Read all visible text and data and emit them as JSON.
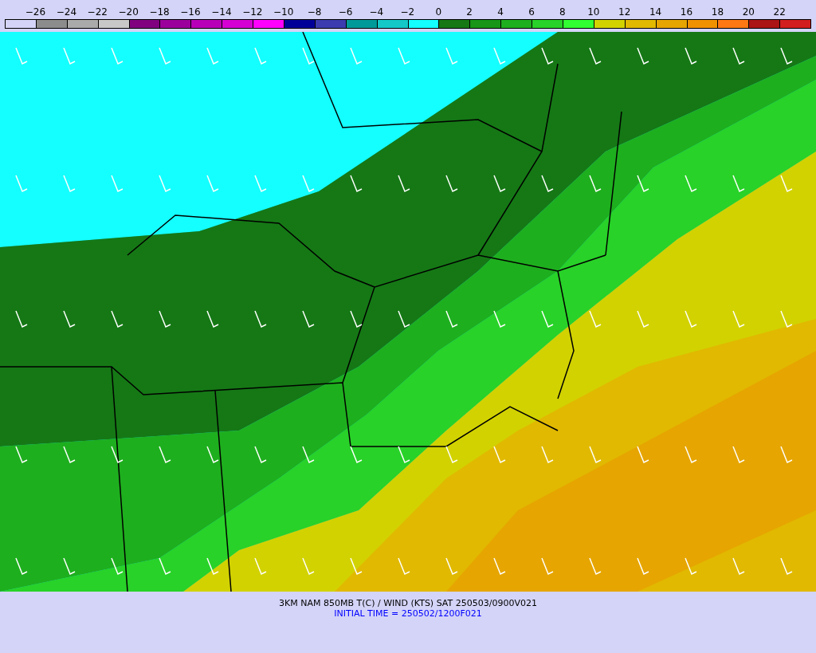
{
  "legend": {
    "labels": [
      "−26",
      "−24",
      "−22",
      "−20",
      "−18",
      "−16",
      "−14",
      "−12",
      "−10",
      "−8",
      "−6",
      "−4",
      "−2",
      "0",
      "2",
      "4",
      "6",
      "8",
      "10",
      "12",
      "14",
      "16",
      "18",
      "20",
      "22"
    ],
    "swatches": [
      {
        "color": "#d4d4f8"
      },
      {
        "color": "#8c8c8c"
      },
      {
        "color": "#aaaaaa"
      },
      {
        "color": "#c8c8c8"
      },
      {
        "color": "#800080"
      },
      {
        "color": "#9c009c"
      },
      {
        "color": "#b800b8"
      },
      {
        "color": "#d400d4"
      },
      {
        "color": "#ff00ff"
      },
      {
        "color": "#000099"
      },
      {
        "color": "#3c3cb0"
      },
      {
        "color": "#009999"
      },
      {
        "color": "#14c8c8"
      },
      {
        "color": "#14ffff"
      },
      {
        "color": "#157815"
      },
      {
        "color": "#179617"
      },
      {
        "color": "#1eaf1e"
      },
      {
        "color": "#28d228"
      },
      {
        "color": "#32ff32"
      },
      {
        "color": "#d2d200"
      },
      {
        "color": "#e1b900"
      },
      {
        "color": "#e6a500"
      },
      {
        "color": "#f09100"
      },
      {
        "color": "#ff7814"
      },
      {
        "color": "#aa1414"
      },
      {
        "color": "#d21e1e"
      }
    ]
  },
  "caption": {
    "title": "3KM NAM 850MB T(C) / WIND (KTS) SAT 250503/0900V021",
    "initial_time": "INITIAL TIME = 250502/1200F021"
  }
}
